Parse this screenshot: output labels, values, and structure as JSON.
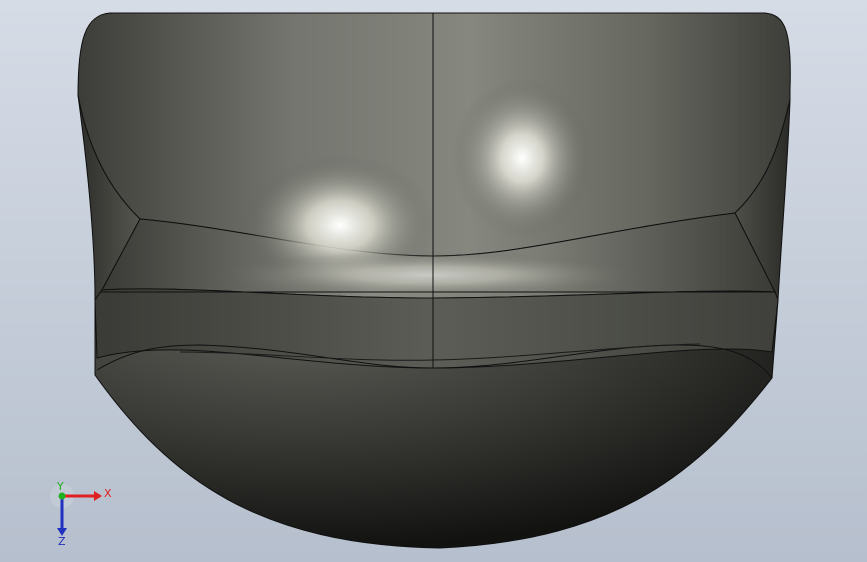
{
  "viewport": {
    "background_top": "#d6dce6",
    "background_bottom": "#b6bfcd"
  },
  "model": {
    "body_color": "#3a3b36",
    "edge_color": "#101010",
    "highlight_color": "#ffffff"
  },
  "triad": {
    "x_label": "X",
    "y_label": "Y",
    "z_label": "Z",
    "x_color": "#e02020",
    "y_color": "#20b020",
    "z_color": "#2030c0"
  }
}
